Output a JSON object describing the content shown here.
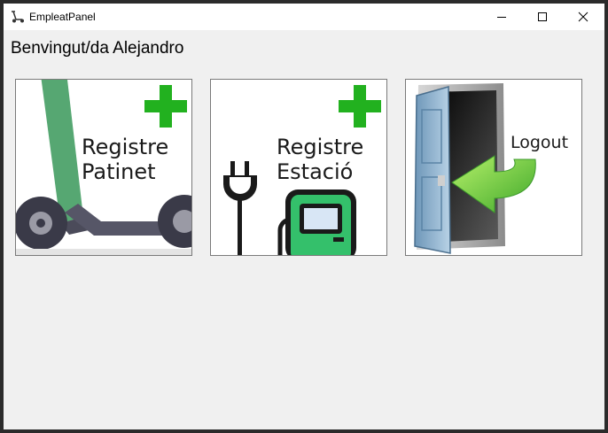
{
  "window": {
    "title": "EmpleatPanel",
    "app_icon": "scooter-icon",
    "controls": [
      "minimize-icon",
      "maximize-icon",
      "close-icon"
    ]
  },
  "main": {
    "welcome": "Benvingut/da Alejandro",
    "tiles": [
      {
        "icon": "scooter-add-icon",
        "line1": "Registre",
        "line2": "Patinet"
      },
      {
        "icon": "charging-station-add-icon",
        "line1": "Registre",
        "line2": "Estació"
      },
      {
        "icon": "logout-door-icon",
        "line1": "Logout"
      }
    ]
  },
  "colors": {
    "plus_green": "#22b11f",
    "scooter_green": "#56a772",
    "station_green": "#34c06b",
    "arrow_green": "#6fd13c"
  }
}
